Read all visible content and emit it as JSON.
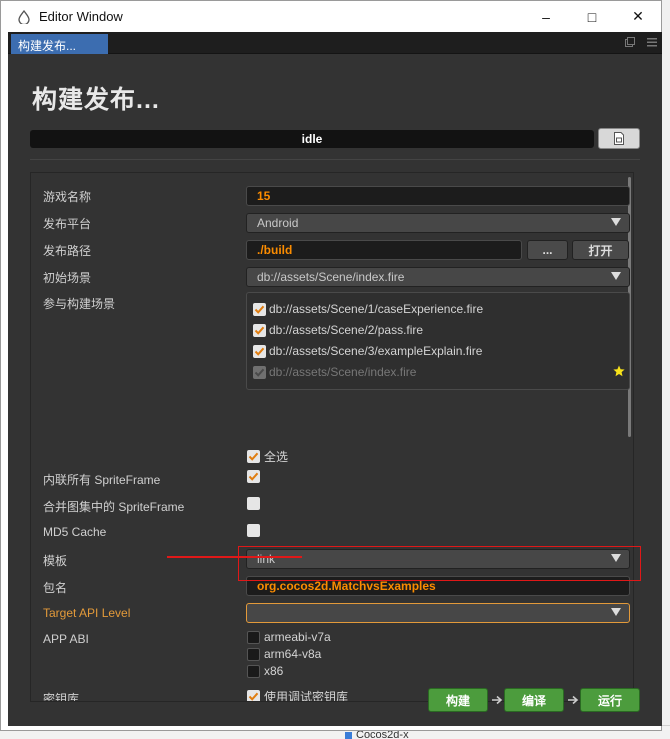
{
  "window": {
    "title": "Editor Window",
    "controls": [
      "–",
      "□",
      "✕"
    ]
  },
  "tab": {
    "label": "构建发布..."
  },
  "panel": {
    "heading": "构建发布...",
    "status": "idle"
  },
  "form": {
    "game_name": {
      "label": "游戏名称",
      "value": "15"
    },
    "platform": {
      "label": "发布平台",
      "value": "Android"
    },
    "build_path": {
      "label": "发布路径",
      "value": "./build",
      "browse_label": "...",
      "open_label": "打开"
    },
    "start_scene": {
      "label": "初始场景",
      "value": "db://assets/Scene/index.fire"
    },
    "included_scenes": {
      "label": "参与构建场景",
      "items": [
        {
          "path": "db://assets/Scene/1/caseExperience.fire",
          "checked": true
        },
        {
          "path": "db://assets/Scene/2/pass.fire",
          "checked": true
        },
        {
          "path": "db://assets/Scene/3/exampleExplain.fire",
          "checked": true
        },
        {
          "path": "db://assets/Scene/index.fire",
          "checked": true,
          "disabled": true
        }
      ],
      "select_all": "全选"
    },
    "inline_spriteframe": {
      "label": "内联所有 SpriteFrame",
      "checked": true
    },
    "merge_spriteframe": {
      "label": "合并图集中的 SpriteFrame",
      "checked": false
    },
    "md5_cache": {
      "label": "MD5 Cache",
      "checked": false
    },
    "template": {
      "label": "模板",
      "value": "link"
    },
    "package_name": {
      "label": "包名",
      "value": "org.cocos2d.MatchvsExamples"
    },
    "target_api": {
      "label": "Target API Level",
      "value": ""
    },
    "app_abi": {
      "label": "APP ABI",
      "options": [
        {
          "name": "armeabi-v7a",
          "checked": false
        },
        {
          "name": "arm64-v8a",
          "checked": false
        },
        {
          "name": "x86",
          "checked": false
        }
      ]
    },
    "keystore": {
      "label": "密钥库",
      "debug_label": "使用调试密钥库",
      "checked": true
    }
  },
  "actions": {
    "build": "构建",
    "compile": "编译",
    "run": "运行"
  },
  "background": {
    "tab_label": "Cocos2d-x"
  },
  "colors": {
    "accent": "#fb8c00",
    "tab": "#3c6db0",
    "action_green": "#4c9c3d",
    "annotation_red": "#e01818"
  }
}
